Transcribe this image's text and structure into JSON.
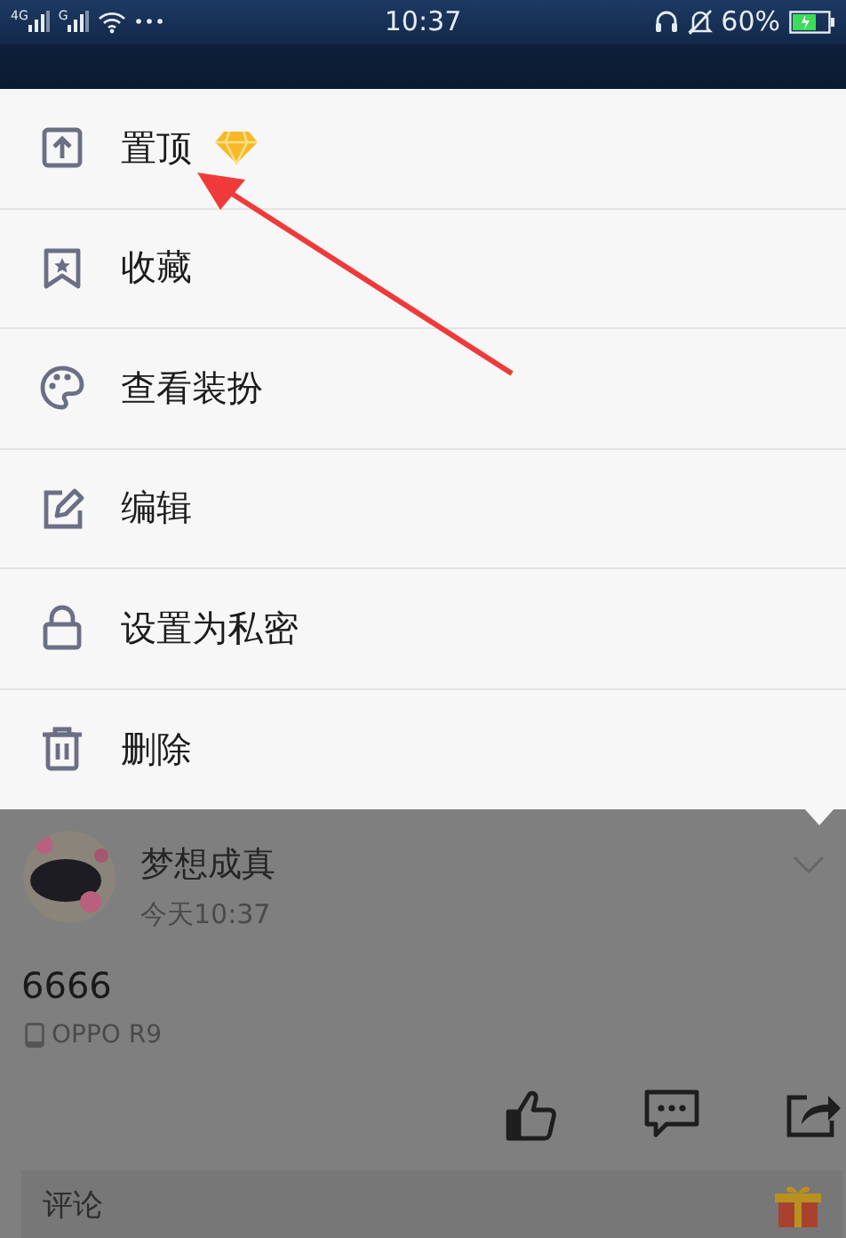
{
  "status_bar": {
    "network_1": "4G",
    "network_2": "G",
    "time": "10:37",
    "battery": "60%"
  },
  "menu": {
    "items": [
      {
        "kind": "pin",
        "label": "置顶",
        "premium": true
      },
      {
        "kind": "bookmark",
        "label": "收藏",
        "premium": false
      },
      {
        "kind": "palette",
        "label": "查看装扮",
        "premium": false
      },
      {
        "kind": "edit",
        "label": "编辑",
        "premium": false
      },
      {
        "kind": "lock",
        "label": "设置为私密",
        "premium": false
      },
      {
        "kind": "delete",
        "label": "删除",
        "premium": false
      }
    ]
  },
  "post": {
    "author": "梦想成真",
    "time": "今天10:37",
    "text": "6666",
    "device": "OPPO R9"
  },
  "comment": {
    "placeholder": "评论"
  }
}
